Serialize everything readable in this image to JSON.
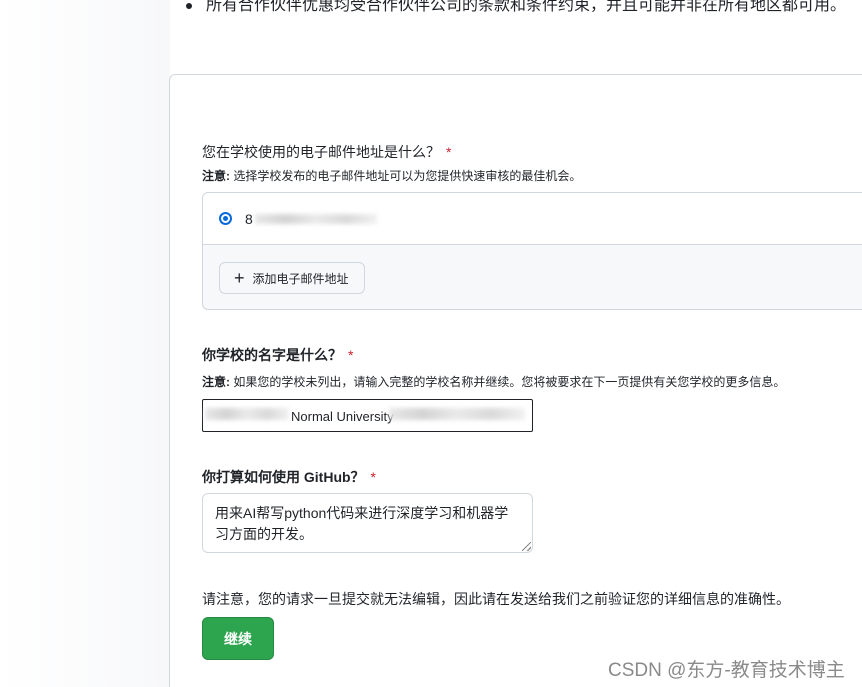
{
  "top_note": "所有合作伙伴优惠均受合作伙伴公司的条款和条件约束，并且可能并非在所有地区都可用。",
  "email_section": {
    "question": "您在学校使用的电子邮件地址是什么？",
    "required_mark": "*",
    "note_prefix": "注意:",
    "note_text": "选择学校发布的电子邮件地址可以为您提供快速审核的最佳机会。",
    "selected_email": "8",
    "add_email_label": "添加电子邮件地址"
  },
  "school_section": {
    "question": "你学校的名字是什么？",
    "required_mark": "*",
    "note_prefix": "注意:",
    "note_text": "如果您的学校未列出，请输入完整的学校名称并继续。您将被要求在下一页提供有关您学校的更多信息。",
    "value": "Normal University"
  },
  "usage_section": {
    "question": "你打算如何使用 GitHub？",
    "required_mark": "*",
    "value": "用来AI帮写python代码来进行深度学习和机器学习方面的开发。"
  },
  "warning_text": "请注意，您的请求一旦提交就无法编辑，因此请在发送给我们之前验证您的详细信息的准确性。",
  "continue_label": "继续",
  "watermark": "CSDN @东方-教育技术博主",
  "colors": {
    "primary_green": "#2da44e",
    "required_red": "#cf222e",
    "radio_blue": "#0969da",
    "border": "#d0d7de"
  },
  "icons": {
    "add": "plus-icon"
  }
}
